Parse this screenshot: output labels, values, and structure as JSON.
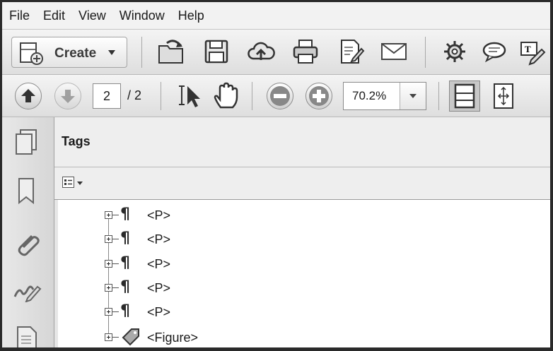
{
  "menu": [
    "File",
    "Edit",
    "View",
    "Window",
    "Help"
  ],
  "toolbar": {
    "create_label": "Create",
    "icons": [
      "open-icon",
      "save-icon",
      "cloud-upload-icon",
      "print-icon",
      "edit-document-icon",
      "email-icon",
      "gear-icon",
      "comment-icon",
      "fill-sign-icon"
    ]
  },
  "nav": {
    "page_number": "2",
    "page_total": "/ 2",
    "zoom": "70.2%"
  },
  "left_rail_icons": [
    "pages-icon",
    "bookmark-icon",
    "attachment-icon",
    "signature-icon",
    "document-icon"
  ],
  "panel": {
    "title": "Tags",
    "tree": [
      {
        "icon": "paragraph-icon",
        "label": "<P>"
      },
      {
        "icon": "paragraph-icon",
        "label": "<P>"
      },
      {
        "icon": "paragraph-icon",
        "label": "<P>"
      },
      {
        "icon": "paragraph-icon",
        "label": "<P>"
      },
      {
        "icon": "paragraph-icon",
        "label": "<P>"
      },
      {
        "icon": "figure-tag-icon",
        "label": "<Figure>"
      }
    ]
  }
}
